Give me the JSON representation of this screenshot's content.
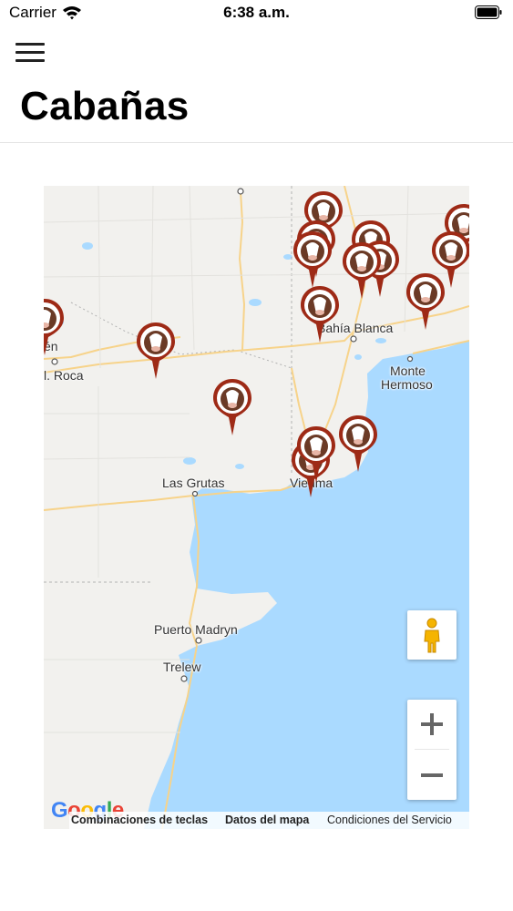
{
  "status_bar": {
    "carrier": "Carrier",
    "time": "6:38 a.m."
  },
  "header": {
    "title": "Cabañas"
  },
  "map": {
    "labels": {
      "bahia_blanca": "Bahía Blanca",
      "monte": "Monte",
      "hermoso": "Hermoso",
      "roca": "l. Roca",
      "en": "én",
      "las_grutas": "Las Grutas",
      "viedma": "Viedma",
      "puerto_madryn": "Puerto Madryn",
      "trelew": "Trelew"
    },
    "logo": "Google",
    "attribution": {
      "keyboard": "Combinaciones de teclas",
      "data": "Datos del mapa",
      "terms": "Condiciones del Servicio"
    },
    "controls": {
      "zoom_in": "+",
      "zoom_out": "−"
    },
    "colors": {
      "land": "#f2f1ee",
      "water": "#aadaff",
      "road": "#f7d38a",
      "pin": "#9e2a16"
    }
  }
}
